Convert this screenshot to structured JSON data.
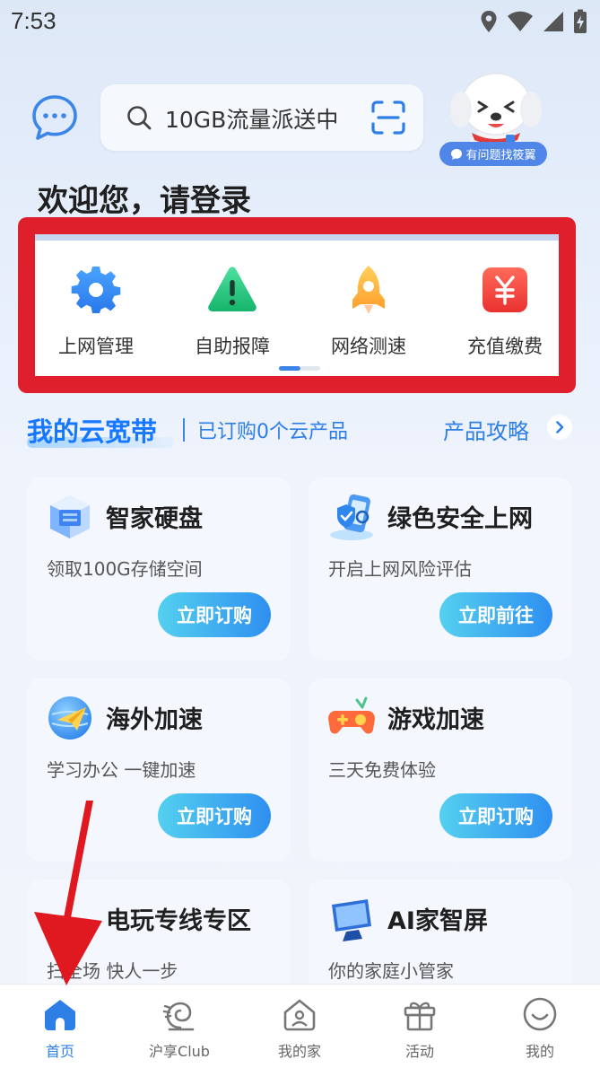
{
  "status_bar": {
    "time": "7:53"
  },
  "header": {
    "search_placeholder": "10GB流量派送中",
    "assistant_badge": "有问题找筱翼",
    "welcome": "欢迎您，请登录"
  },
  "quick_actions": [
    {
      "label": "上网管理",
      "icon": "gear-icon"
    },
    {
      "label": "自助报障",
      "icon": "warning-icon"
    },
    {
      "label": "网络测速",
      "icon": "rocket-icon"
    },
    {
      "label": "充值缴费",
      "icon": "yuan-icon"
    }
  ],
  "section": {
    "title": "我的云宽带",
    "subtitle": "已订购0个云产品",
    "link": "产品攻略"
  },
  "cards": [
    {
      "title": "智家硬盘",
      "desc": "领取100G存储空间",
      "button": "立即订购",
      "icon": "hard-disk-icon"
    },
    {
      "title": "绿色安全上网",
      "desc": "开启上网风险评估",
      "button": "立即前往",
      "icon": "shield-phone-icon"
    },
    {
      "title": "海外加速",
      "desc": "学习办公 一键加速",
      "button": "立即订购",
      "icon": "globe-plane-icon"
    },
    {
      "title": "游戏加速",
      "desc": "三天免费体验",
      "button": "立即订购",
      "icon": "gamepad-icon"
    },
    {
      "title": "电玩专线专区",
      "desc": "扫全场 快人一步",
      "icon": "game-line-icon"
    },
    {
      "title": "AI家智屏",
      "desc": "你的家庭小管家",
      "icon": "smart-screen-icon"
    }
  ],
  "tabbar": [
    {
      "label": "首页",
      "icon": "home-icon",
      "active": true
    },
    {
      "label": "沪享Club",
      "icon": "club-icon",
      "active": false
    },
    {
      "label": "我的家",
      "icon": "house-icon",
      "active": false
    },
    {
      "label": "活动",
      "icon": "gift-icon",
      "active": false
    },
    {
      "label": "我的",
      "icon": "smile-icon",
      "active": false
    }
  ],
  "colors": {
    "accent": "#2d7fe6",
    "highlight_box": "#e01f2c",
    "annotation_arrow": "#e0181f"
  }
}
